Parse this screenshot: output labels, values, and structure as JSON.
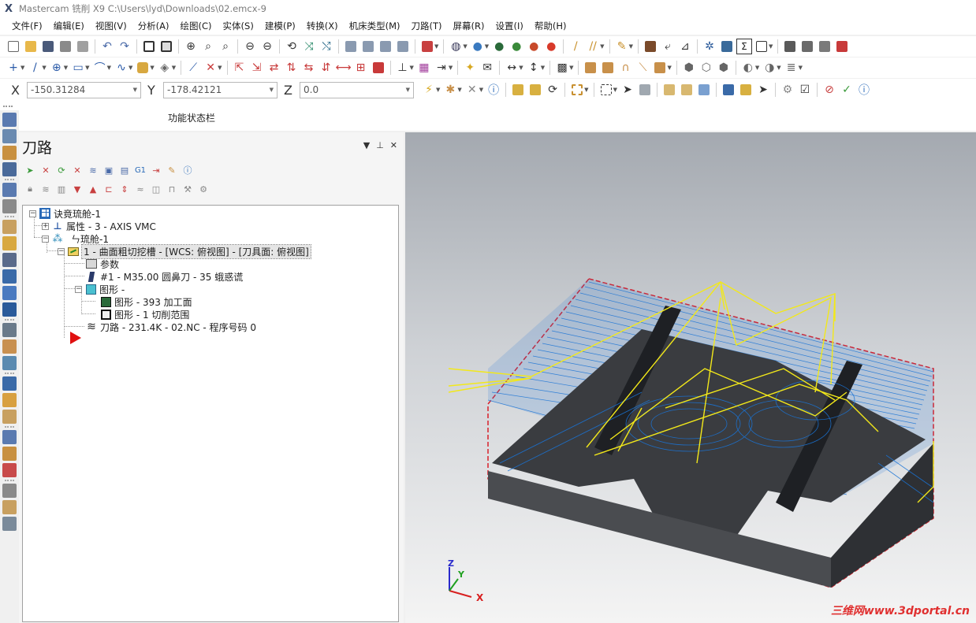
{
  "app": {
    "title": "Mastercam 铣削 X9  C:\\Users\\lyd\\Downloads\\02.emcx-9"
  },
  "menu": [
    "文件(F)",
    "编辑(E)",
    "视图(V)",
    "分析(A)",
    "绘图(C)",
    "实体(S)",
    "建模(P)",
    "转换(X)",
    "机床类型(M)",
    "刀路(T)",
    "屏幕(R)",
    "设置(I)",
    "帮助(H)"
  ],
  "coords": {
    "x_label": "X",
    "x_value": "-150.31284",
    "y_label": "Y",
    "y_value": "-178.42121",
    "z_label": "Z",
    "z_value": "0.0"
  },
  "status_bar_label": "功能状态栏",
  "panel": {
    "title": "刀路",
    "tree": {
      "root": "诀竟琉舱-1",
      "properties": "属性 - 3 - AXIS VMC",
      "group": "ㄣ琉舱-1",
      "operation": "1 - 曲面粗切挖槽 - [WCS: 俯视图] - [刀具面: 俯视图]",
      "params": "参数",
      "tool": "#1 - M35.00 圆鼻刀 - 35 蛾惑谎",
      "geometry": "图形 -",
      "geo_machining": "图形 - 393 加工面",
      "geo_boundary": "图形 - 1 切削范围",
      "toolpath": "刀路 - 231.4K - 02.NC - 程序号码 0"
    }
  },
  "viewport": {
    "axis_x": "X",
    "axis_y": "Y",
    "axis_z": "Z",
    "watermark": "三维网www.3dportal.cn"
  },
  "colors": {
    "toolpath_blue": "#1a74d6",
    "rapid_yellow": "#f2e81a",
    "stock_red": "#d8202a",
    "part_dark": "#3a3c40"
  }
}
